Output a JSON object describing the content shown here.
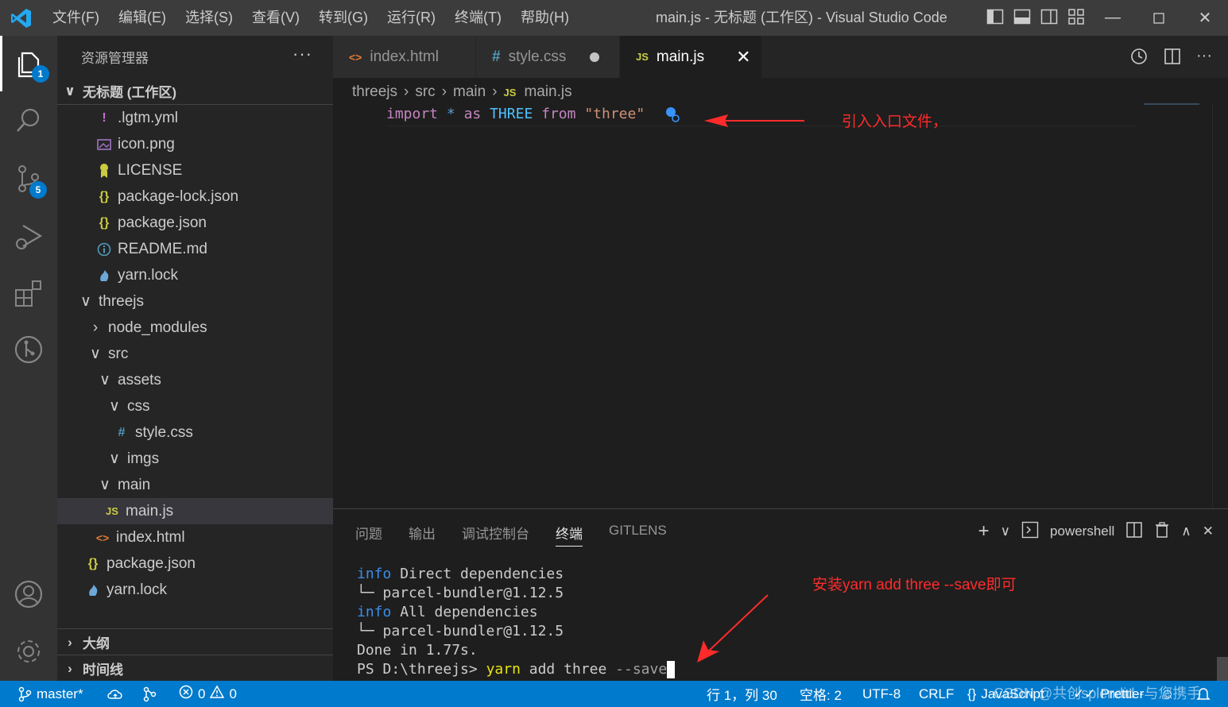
{
  "titlebar": {
    "menu": [
      "文件(F)",
      "编辑(E)",
      "选择(S)",
      "查看(V)",
      "转到(G)",
      "运行(R)",
      "终端(T)",
      "帮助(H)"
    ],
    "title": "main.js - 无标题 (工作区) - Visual Studio Code"
  },
  "activitybar": {
    "explorer_badge": "1",
    "scm_badge": "5"
  },
  "sidebar": {
    "header": "资源管理器",
    "workspace": "无标题 (工作区)",
    "files": [
      {
        "label": ".lgtm.yml",
        "icon": "!"
      },
      {
        "label": "icon.png"
      },
      {
        "label": "LICENSE"
      },
      {
        "label": "package-lock.json",
        "icon": "{}"
      },
      {
        "label": "package.json",
        "icon": "{}"
      },
      {
        "label": "README.md"
      },
      {
        "label": "yarn.lock"
      },
      {
        "label": "threejs"
      },
      {
        "label": "node_modules"
      },
      {
        "label": "src"
      },
      {
        "label": "assets"
      },
      {
        "label": "css"
      },
      {
        "label": "style.css",
        "icon": "#"
      },
      {
        "label": "imgs"
      },
      {
        "label": "main"
      },
      {
        "label": "main.js",
        "icon": "JS"
      },
      {
        "label": "index.html",
        "icon": "<>"
      },
      {
        "label": "package.json",
        "icon": "{}"
      },
      {
        "label": "yarn.lock"
      }
    ],
    "outline": "大纲",
    "timeline": "时间线"
  },
  "tabs": [
    {
      "label": "index.html",
      "icon": "<>"
    },
    {
      "label": "style.css",
      "icon": "#"
    },
    {
      "label": "main.js",
      "icon": "JS"
    }
  ],
  "breadcrumb": [
    "threejs",
    "src",
    "main",
    "main.js"
  ],
  "breadcrumb_icon": "JS",
  "editor": {
    "code": {
      "import": "import",
      "star": "*",
      "as": "as",
      "name": "THREE",
      "from": "from",
      "module": "\"three\""
    },
    "annotation": "引入入口文件，"
  },
  "panel": {
    "tabs": [
      "问题",
      "输出",
      "调试控制台",
      "终端",
      "GITLENS"
    ],
    "shell": "powershell",
    "terminal": {
      "line1_tag": "info",
      "line1_text": " Direct dependencies",
      "line2": "└─ parcel-bundler@1.12.5",
      "line3_tag": "info",
      "line3_text": " All dependencies",
      "line4": "└─ parcel-bundler@1.12.5",
      "line5": "Done in 1.77s.",
      "prompt": "PS D:\\threejs> ",
      "cmd": "yarn",
      "cmd_rest": " add three ",
      "cmd_flag": "--save"
    },
    "annotation": "安装yarn add three --save即可"
  },
  "statusbar": {
    "branch": "master*",
    "errors": "0",
    "warnings": "0",
    "position": "行 1，列 30",
    "spaces": "空格: 2",
    "encoding": "UTF-8",
    "eol": "CRLF",
    "language": "JavaScript",
    "formatter": "Prettier",
    "watermark": "CSDN @共创splendid--与您携手"
  },
  "colors": {
    "accent": "#007acc",
    "annotation": "#ff2b2b"
  }
}
